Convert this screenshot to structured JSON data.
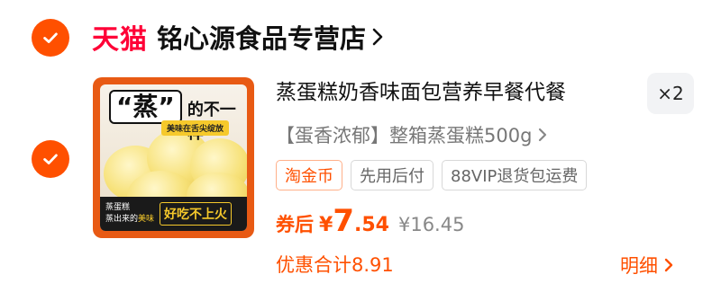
{
  "store": {
    "brand": "天猫",
    "name": "铭心源食品专营店"
  },
  "product": {
    "title": "蒸蛋糕奶香味面包营养早餐代餐",
    "quantity": "×2",
    "sku": "【蛋香浓郁】整箱蒸蛋糕500g",
    "tags": [
      "淘金币",
      "先用后付",
      "88VIP退货包运费"
    ],
    "thumbnail": {
      "headline_big": "“蒸”",
      "headline_rest": "的不一样",
      "tag": "美味在舌尖绽放",
      "bottom_line1": "蒸蛋糕",
      "bottom_line2_a": "蒸出来的",
      "bottom_line2_b": "美味",
      "bottom_badge": "好吃不上火"
    }
  },
  "price": {
    "label": "券后",
    "currency": "¥",
    "integer": "7",
    "decimal": ".54",
    "original": "¥16.45"
  },
  "discount": {
    "text": "优惠合计8.91"
  },
  "detail": {
    "label": "明细"
  },
  "colors": {
    "accent": "#ff5000",
    "tmall": "#ff0036"
  },
  "icons": {
    "check": "check-circle-icon",
    "chevron": "chevron-right-icon"
  }
}
